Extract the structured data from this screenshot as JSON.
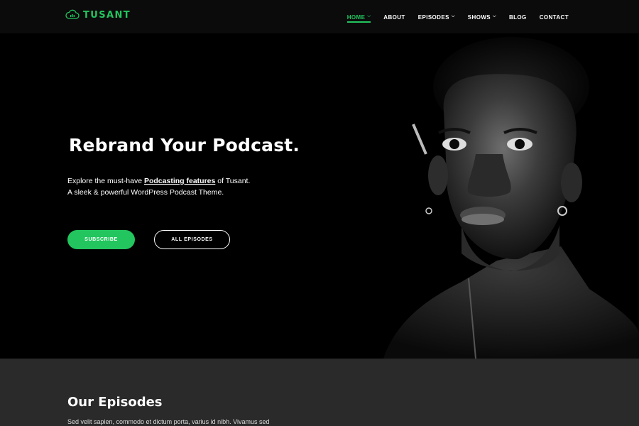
{
  "header": {
    "logo_text": "TUSANT",
    "nav": [
      {
        "label": "HOME",
        "has_dropdown": true,
        "active": true
      },
      {
        "label": "ABOUT",
        "has_dropdown": false,
        "active": false
      },
      {
        "label": "EPISODES",
        "has_dropdown": true,
        "active": false
      },
      {
        "label": "SHOWS",
        "has_dropdown": true,
        "active": false
      },
      {
        "label": "BLOG",
        "has_dropdown": false,
        "active": false
      },
      {
        "label": "CONTACT",
        "has_dropdown": false,
        "active": false
      }
    ]
  },
  "hero": {
    "title": "Rebrand Your Podcast.",
    "desc_prefix": "Explore the must-have ",
    "desc_link": "Podcasting features",
    "desc_suffix": " of Tusant.",
    "desc_line2": "A sleek & powerful WordPress Podcast Theme.",
    "subscribe_label": "SUBSCRIBE",
    "all_episodes_label": "ALL EPISODES"
  },
  "episodes": {
    "title": "Our Episodes",
    "text": "Sed velit sapien, commodo et dictum porta, varius id nibh. Vivamus sed"
  },
  "colors": {
    "accent": "#22c55e",
    "header_bg": "#0b0b0b",
    "hero_bg": "#000000",
    "section_bg": "#2a2a2a"
  },
  "icons": {
    "logo": "cloud-podcast-icon",
    "dropdown": "chevron-down-icon"
  }
}
